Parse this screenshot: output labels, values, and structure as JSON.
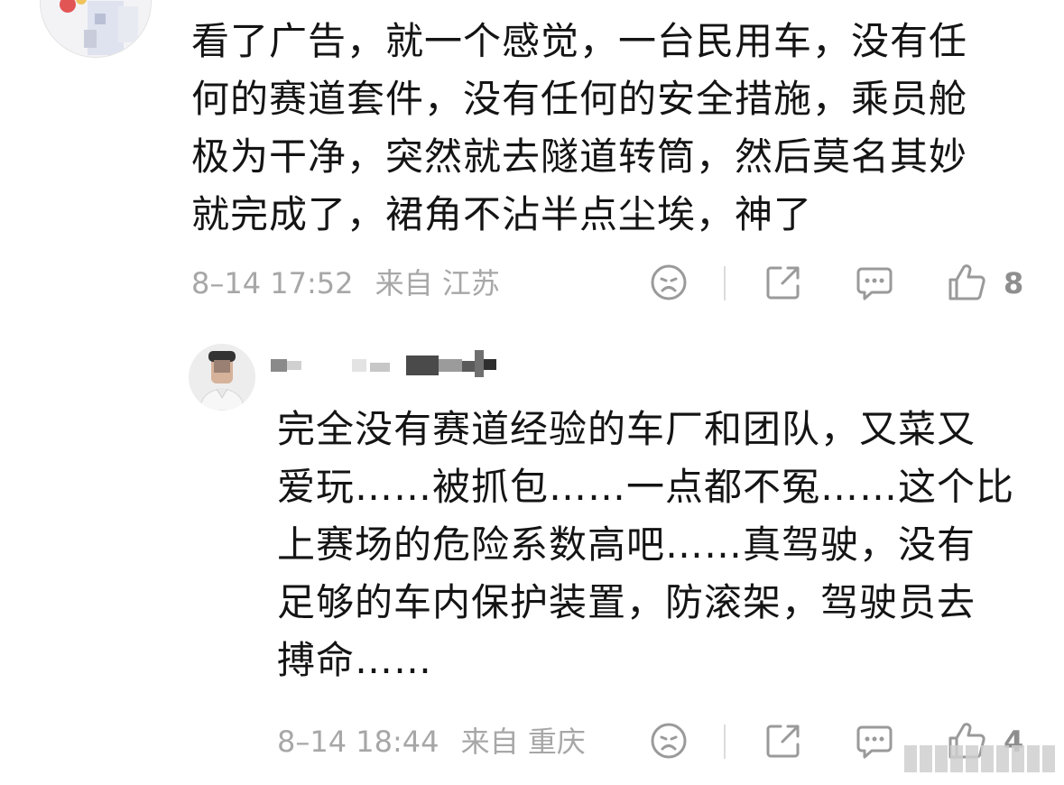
{
  "comments": [
    {
      "text": "看了广告，就一个感觉，一台民用车，没有任\n何的赛道套件，没有任何的安全措施，乘员舱\n极为干净，突然就去隧道转筒，然后莫名其妙\n就完成了，裙角不沾半点尘埃，神了",
      "date": "8–14 17:52",
      "location": "来自 江苏",
      "like_count": "8"
    },
    {
      "text": "完全没有赛道经验的车厂和团队，又菜又\n爱玩……被抓包……一点都不冤……这个比\n上赛场的危险系数高吧……真驾驶，没有\n足够的车内保护装置，防滚架，驾驶员去\n搏命……",
      "date": "8–14 18:44",
      "location": "来自 重庆",
      "like_count": "4"
    }
  ],
  "icons": {
    "dislike": "sad-face-icon",
    "share": "share-icon",
    "comment": "comment-bubble-icon",
    "like": "thumbs-up-icon"
  },
  "colors": {
    "text": "#141414",
    "meta": "#a7a7a7",
    "icon": "#9a9a9a",
    "background": "#ffffff"
  }
}
